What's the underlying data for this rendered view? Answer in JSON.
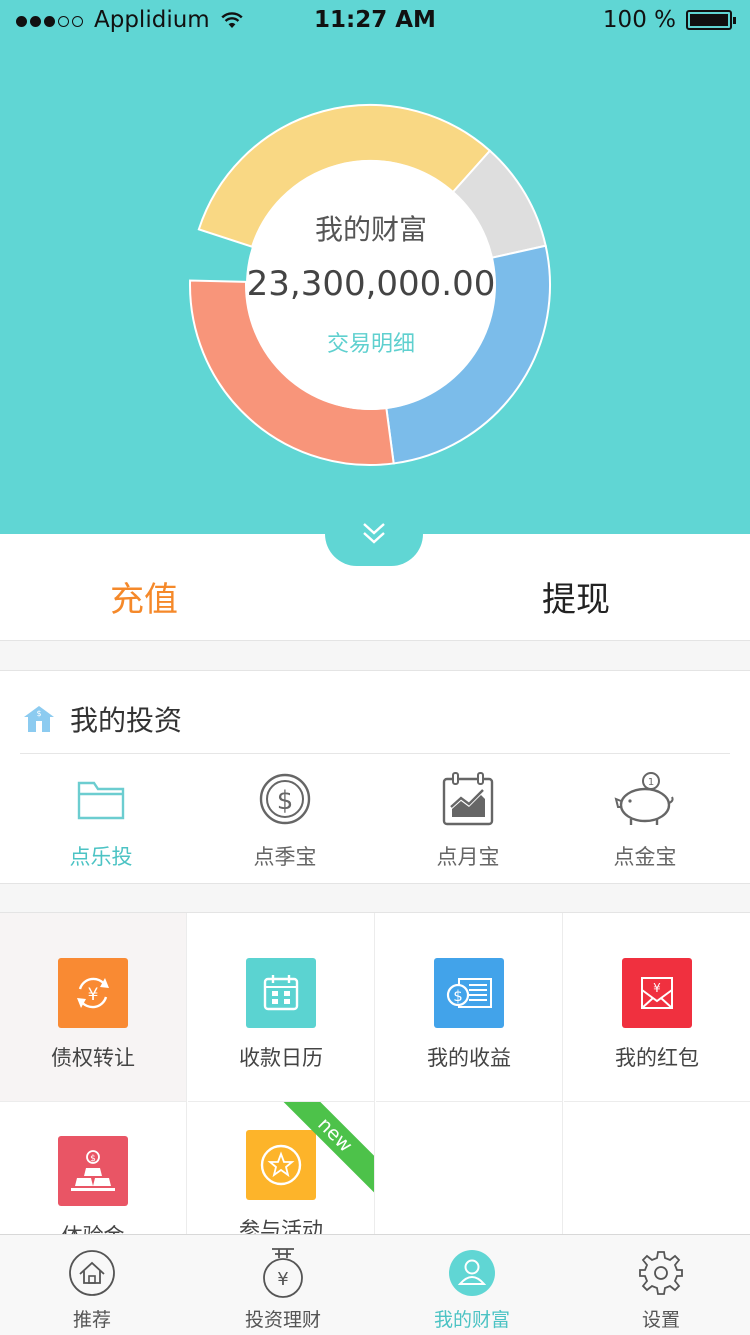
{
  "status_bar": {
    "carrier": "Applidium",
    "time": "11:27 AM",
    "battery": "100 %"
  },
  "wealth": {
    "title": "我的财富",
    "amount": "23,300,000.00",
    "detail_link": "交易明细",
    "segment_colors": [
      "#f9d884",
      "#dedede",
      "#7bbcea",
      "#f8957a"
    ],
    "segment_fractions": [
      0.316,
      0.099,
      0.264,
      0.275
    ]
  },
  "actions": {
    "recharge": "充值",
    "withdraw": "提现"
  },
  "investments": {
    "title": "我的投资",
    "products": [
      {
        "label": "点乐投",
        "icon": "folder-icon"
      },
      {
        "label": "点季宝",
        "icon": "dollar-coin-icon"
      },
      {
        "label": "点月宝",
        "icon": "calendar-chart-icon"
      },
      {
        "label": "点金宝",
        "icon": "piggy-bank-icon"
      }
    ]
  },
  "features": [
    {
      "label": "债权转让",
      "icon": "yen-transfer-icon",
      "color": "#f98a33"
    },
    {
      "label": "收款日历",
      "icon": "calendar-icon",
      "color": "#5bd3d1"
    },
    {
      "label": "我的收益",
      "icon": "bill-icon",
      "color": "#42a3ea"
    },
    {
      "label": "我的红包",
      "icon": "red-envelope-icon",
      "color": "#f0303f"
    },
    {
      "label": "体验金",
      "icon": "gold-bars-icon",
      "color": "#e95565"
    },
    {
      "label": "参与活动",
      "icon": "star-icon",
      "color": "#fdb42a",
      "badge": "new"
    }
  ],
  "tabbar": [
    {
      "label": "推荐",
      "icon": "home-icon"
    },
    {
      "label": "投资理财",
      "icon": "yen-hanger-icon"
    },
    {
      "label": "我的财富",
      "icon": "user-icon"
    },
    {
      "label": "设置",
      "icon": "gear-icon"
    }
  ]
}
